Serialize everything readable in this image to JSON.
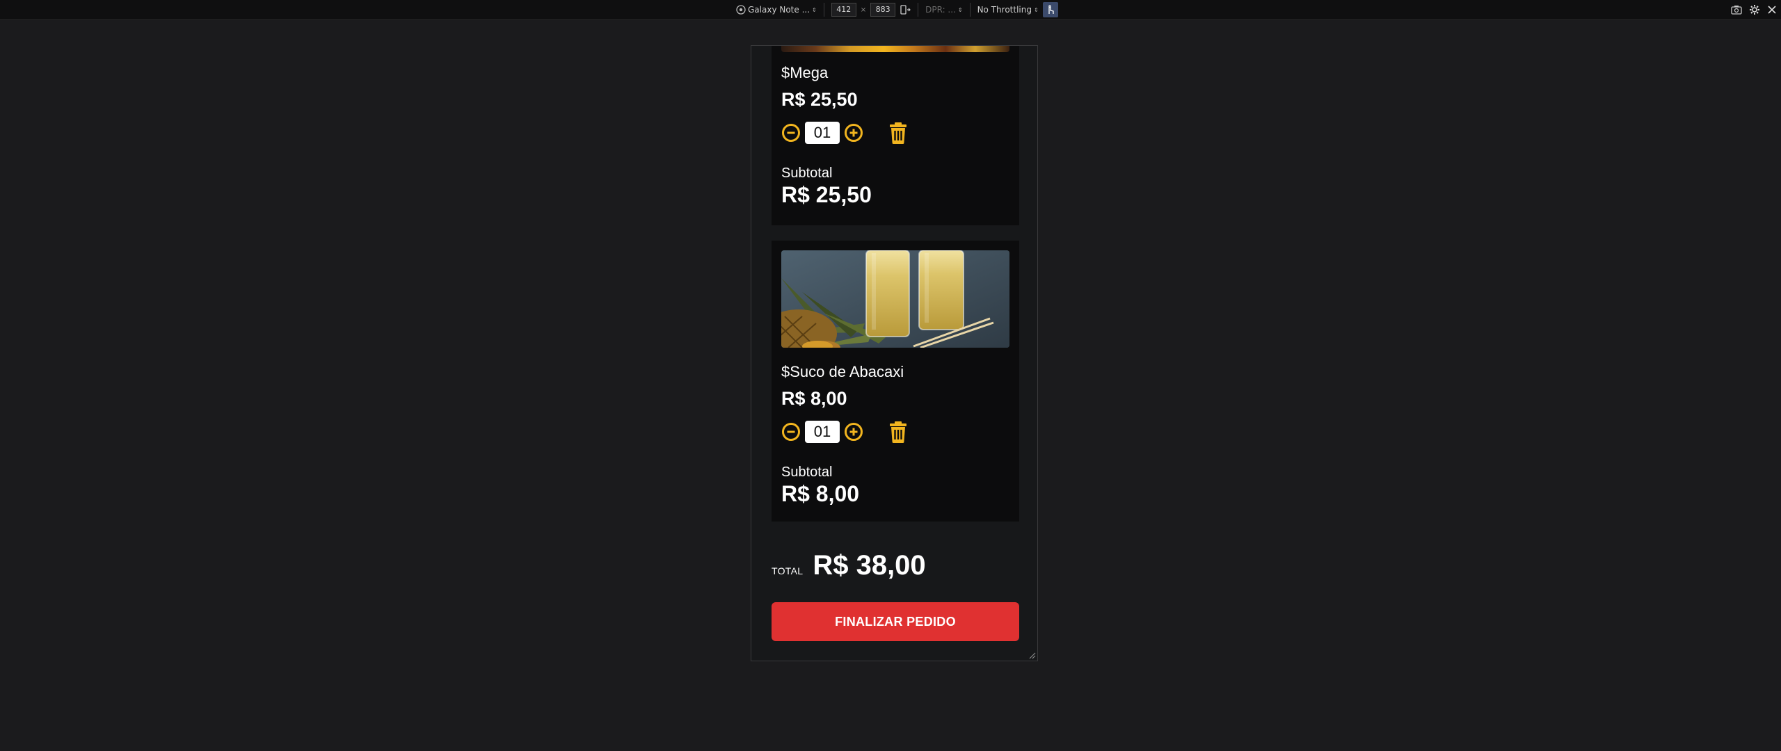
{
  "devtools": {
    "device": "Galaxy Note ...",
    "width": "412",
    "height": "883",
    "times_sign": "×",
    "dpr": "DPR: ...",
    "throttling": "No Throttling"
  },
  "cart": {
    "items": [
      {
        "name": "$Mega",
        "price": "R$ 25,50",
        "quantity": "01",
        "subtotal_label": "Subtotal",
        "subtotal": "R$ 25,50"
      },
      {
        "name": "$Suco de Abacaxi",
        "price": "R$ 8,00",
        "quantity": "01",
        "subtotal_label": "Subtotal",
        "subtotal": "R$ 8,00"
      }
    ],
    "total_label": "TOTAL",
    "total": "R$ 38,00",
    "finalize_label": "FINALIZAR PEDIDO"
  },
  "colors": {
    "accent": "#f2b51f",
    "button": "#e03131",
    "card": "#0c0c0d",
    "background": "#1b1b1d"
  },
  "icons": [
    "device-icon",
    "minus-circle-icon",
    "plus-circle-icon",
    "trash-icon",
    "screenshot-icon",
    "settings-icon",
    "close-icon",
    "touch-icon",
    "rotate-icon"
  ]
}
